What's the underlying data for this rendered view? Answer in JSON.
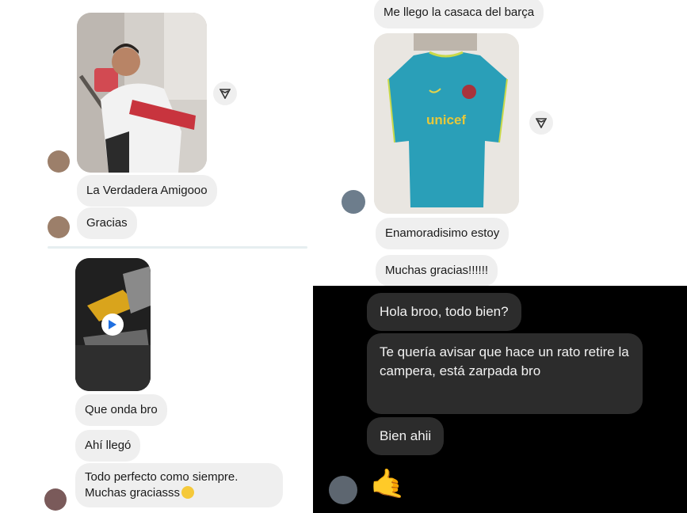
{
  "left_top": {
    "messages": [
      {
        "text": "La Verdadera Amigooo"
      },
      {
        "text": "Gracias"
      }
    ]
  },
  "left_bottom": {
    "messages": [
      {
        "text": "Que onda bro"
      },
      {
        "text": "Ahí llegó"
      },
      {
        "text": "Todo perfecto como siempre."
      },
      {
        "text": "Muchas graciasss"
      }
    ]
  },
  "right_top": {
    "messages": [
      {
        "text": "Me llego la casaca del barça"
      },
      {
        "text": "Enamoradisimo estoy"
      },
      {
        "text": "Muchas gracias!!!!!!"
      }
    ]
  },
  "right_dark": {
    "messages": [
      {
        "text": "Hola broo, todo bien?"
      },
      {
        "text": "Te quería avisar que hace un rato retire la campera, está zarpada bro"
      },
      {
        "text": "Bien ahii"
      }
    ],
    "reaction": "🤙"
  },
  "jersey_text": "unicef",
  "icons": {
    "share": "share-arrow-icon",
    "play": "play-icon",
    "emoji": "grinning-face-emoji-icon"
  },
  "colors": {
    "bubble_light": "#efefef",
    "bubble_dark": "#2c2c2c",
    "dark_bg": "#000000",
    "jersey": "#2a9fb8"
  }
}
